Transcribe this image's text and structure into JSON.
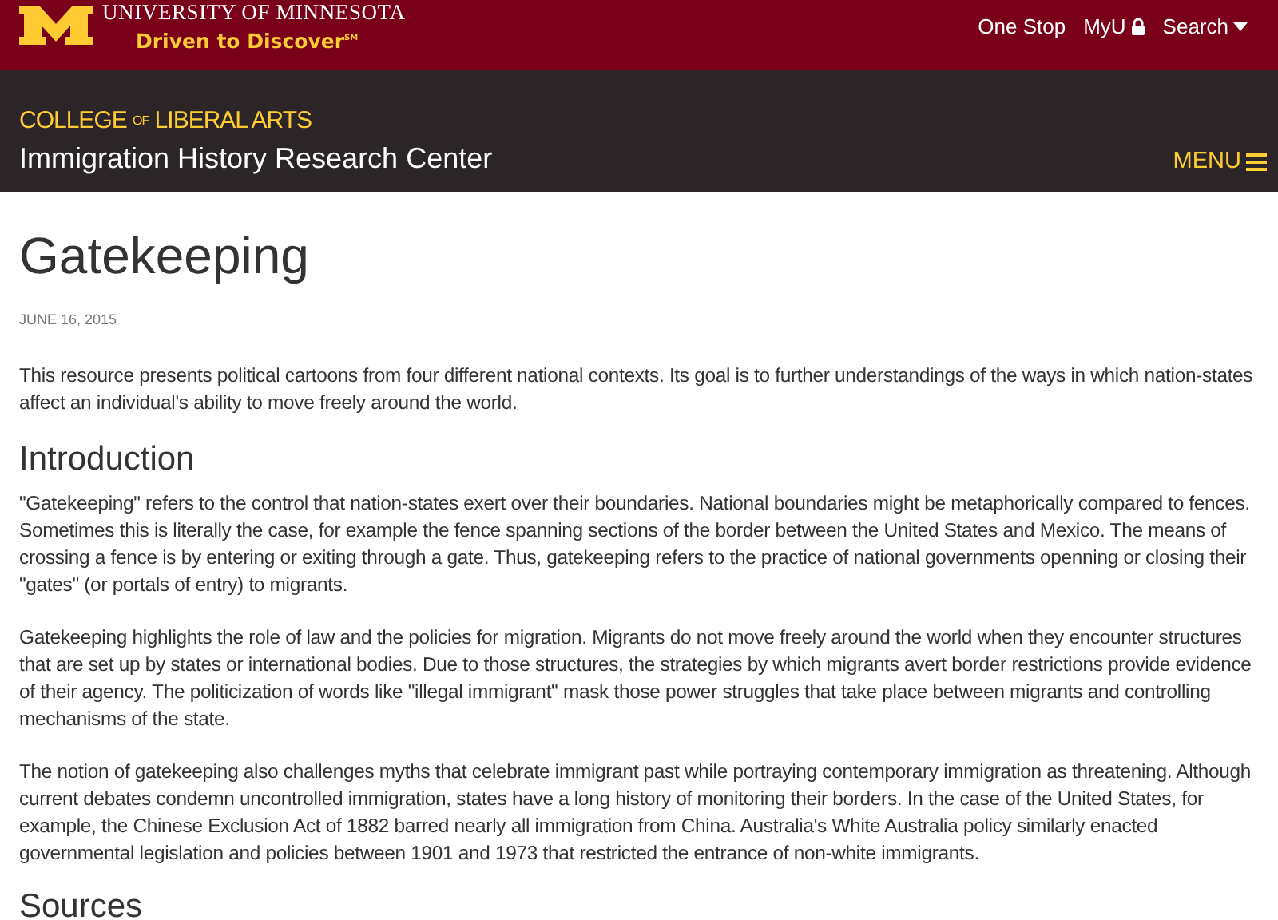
{
  "top_bar": {
    "university": "UNIVERSITY OF MINNESOTA",
    "tagline": "Driven to Discover$^{SM}$",
    "links": [
      {
        "label": "One Stop",
        "kind": "plain"
      },
      {
        "label": "MyU",
        "kind": "secure"
      },
      {
        "label": "Search",
        "kind": "dropdown"
      }
    ]
  },
  "college_bar": {
    "college": "COLLEGE $^{OF}$ LIBERAL ARTS",
    "center": "Immigration History Research Center",
    "menu": "MENU"
  },
  "article": {
    "title": "Gatekeeping",
    "date": "JUNE 16, 2015",
    "blocks": [
      {
        "kind": "paragraph",
        "text": "This resource presents political cartoons from four different national contexts. Its goal is to further understandings of the ways in which nation-states affect an individual's ability to move freely around the world."
      },
      {
        "kind": "heading",
        "text": "Introduction"
      },
      {
        "kind": "paragraph",
        "text": "\"Gatekeeping\" refers to the control that nation-states exert over their boundaries. National boundaries might be metaphorically compared to fences. Sometimes this is literally the case, for example the fence spanning sections of the border between the United States and Mexico. The means of crossing a fence is by entering or exiting through a gate. Thus, gatekeeping refers to the practice of national governments openning or closing their \"gates\" (or portals of entry) to migrants."
      },
      {
        "kind": "paragraph",
        "text": "Gatekeeping highlights the role of law and the policies for migration. Migrants do not move freely around the world when they encounter structures that are set up by states or international bodies. Due to those structures, the strategies by which migrants avert border restrictions provide evidence of their agency. The politicization of words like \"illegal immigrant\" mask those power struggles that take place between migrants and controlling mechanisms of the state."
      },
      {
        "kind": "paragraph",
        "text": "The notion of gatekeeping also challenges myths that celebrate immigrant past while portraying contemporary immigration as threatening. Although current debates condemn uncontrolled immigration, states have a long history of monitoring their borders. In the case of the United States, for example, the Chinese Exclusion Act of 1882 barred nearly all immigration from China. Australia's White Australia policy similarly enacted governmental legislation and policies between 1901 and 1973 that restricted the entrance of non-white immigrants."
      },
      {
        "kind": "heading",
        "text": "Sources"
      }
    ]
  }
}
